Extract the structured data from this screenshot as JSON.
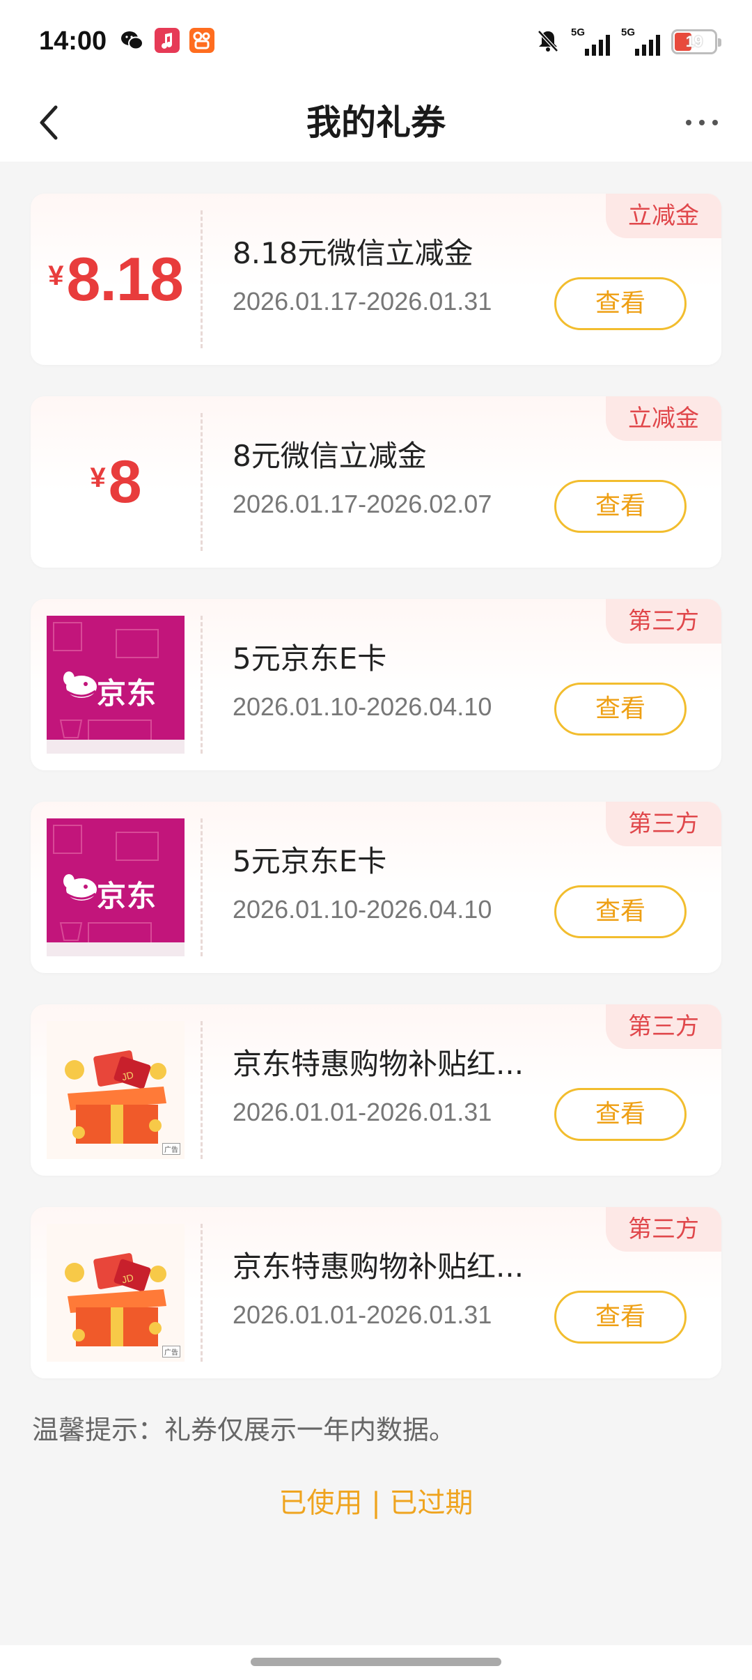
{
  "status_bar": {
    "time": "14:00",
    "apps": [
      "wechat-icon",
      "music-icon",
      "kuaishou-icon"
    ],
    "mute_icon": "bell-off-icon",
    "signal_1_label": "5G",
    "signal_2_label": "5G",
    "battery_level": "19",
    "colors": {
      "battery_low": "#e84a3c"
    }
  },
  "header": {
    "title": "我的礼券"
  },
  "coupons": [
    {
      "type_tag": "立减金",
      "amount_symbol": "¥",
      "amount": "8.18",
      "name": "8.18元微信立减金",
      "date": "2026.01.17-2026.01.31",
      "button": "查看"
    },
    {
      "type_tag": "立减金",
      "amount_symbol": "¥",
      "amount": "8",
      "name": "8元微信立减金",
      "date": "2026.01.17-2026.02.07",
      "button": "查看"
    },
    {
      "type_tag": "第三方",
      "thumb_brand": "京东",
      "name": "5元京东E卡",
      "date": "2026.01.10-2026.04.10",
      "button": "查看"
    },
    {
      "type_tag": "第三方",
      "thumb_brand": "京东",
      "name": "5元京东E卡",
      "date": "2026.01.10-2026.04.10",
      "button": "查看"
    },
    {
      "type_tag": "第三方",
      "thumb_ad": "广告",
      "name": "京东特惠购物补贴红...",
      "date": "2026.01.01-2026.01.31",
      "button": "查看"
    },
    {
      "type_tag": "第三方",
      "thumb_ad": "广告",
      "name": "京东特惠购物补贴红...",
      "date": "2026.01.01-2026.01.31",
      "button": "查看"
    }
  ],
  "footer": {
    "tip": "温馨提示：礼券仅展示一年内数据。",
    "link_used": "已使用",
    "separator": " | ",
    "link_expired": "已过期"
  },
  "colors": {
    "accent_red": "#e83c3c",
    "button_border": "#f2bd2e",
    "button_text": "#ee9f13",
    "jd_magenta": "#c2157b"
  }
}
